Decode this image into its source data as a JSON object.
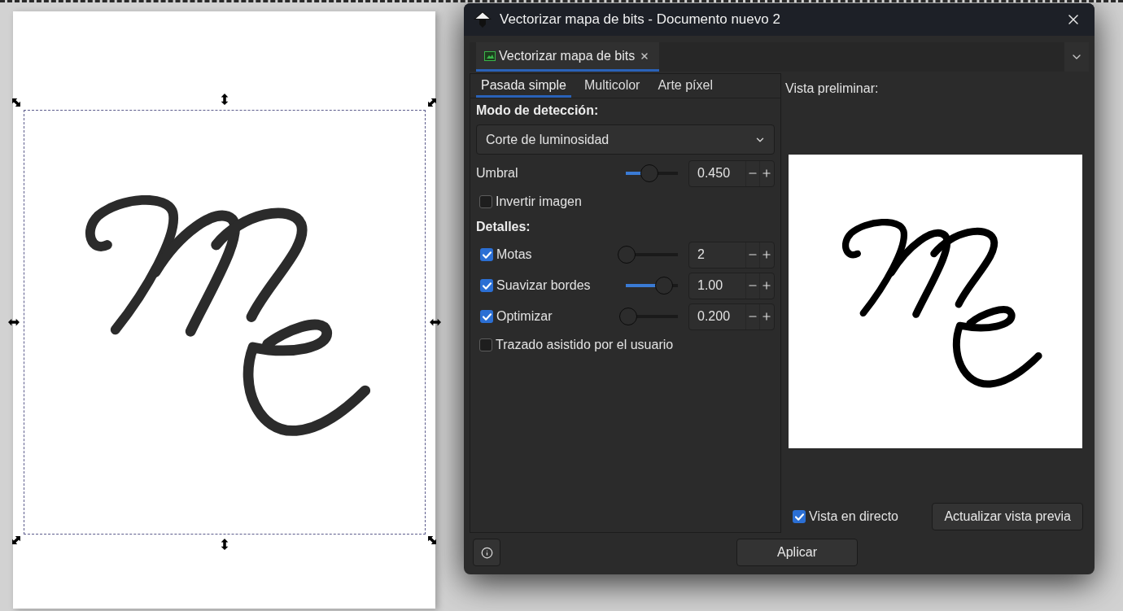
{
  "window": {
    "title": "Vectorizar mapa de bits - Documento nuevo 2"
  },
  "dock_tabs": [
    {
      "label": "Vectorizar mapa de bits",
      "selected": true
    }
  ],
  "mode_tabs": [
    {
      "label": "Pasada simple",
      "selected": true
    },
    {
      "label": "Multicolor",
      "selected": false
    },
    {
      "label": "Arte píxel",
      "selected": false
    }
  ],
  "settings": [
    {
      "kind": "heading",
      "label": "Modo de detección:"
    },
    {
      "kind": "dropdown",
      "value": "Corte de luminosidad"
    },
    {
      "kind": "slider",
      "label": "Umbral",
      "level": 0.45,
      "value": "0.450"
    },
    {
      "kind": "checkbox",
      "label": "Invertir imagen",
      "checked": false
    },
    {
      "kind": "heading",
      "label": "Detalles:"
    },
    {
      "kind": "checkbox_slider",
      "label": "Motas",
      "checked": true,
      "level": 0.02,
      "value": "2"
    },
    {
      "kind": "checkbox_slider",
      "label": "Suavizar bordes",
      "checked": true,
      "level": 0.73,
      "value": "1.00"
    },
    {
      "kind": "checkbox_slider",
      "label": "Optimizar",
      "checked": true,
      "level": 0.04,
      "value": "0.200"
    },
    {
      "kind": "checkbox",
      "label": "Trazado asistido por el usuario",
      "checked": false
    }
  ],
  "preview": {
    "label": "Vista preliminar:",
    "live_preview": {
      "label": "Vista en directo",
      "checked": true
    },
    "update_button": "Actualizar vista previa"
  },
  "footer": {
    "apply_button": "Aplicar"
  }
}
